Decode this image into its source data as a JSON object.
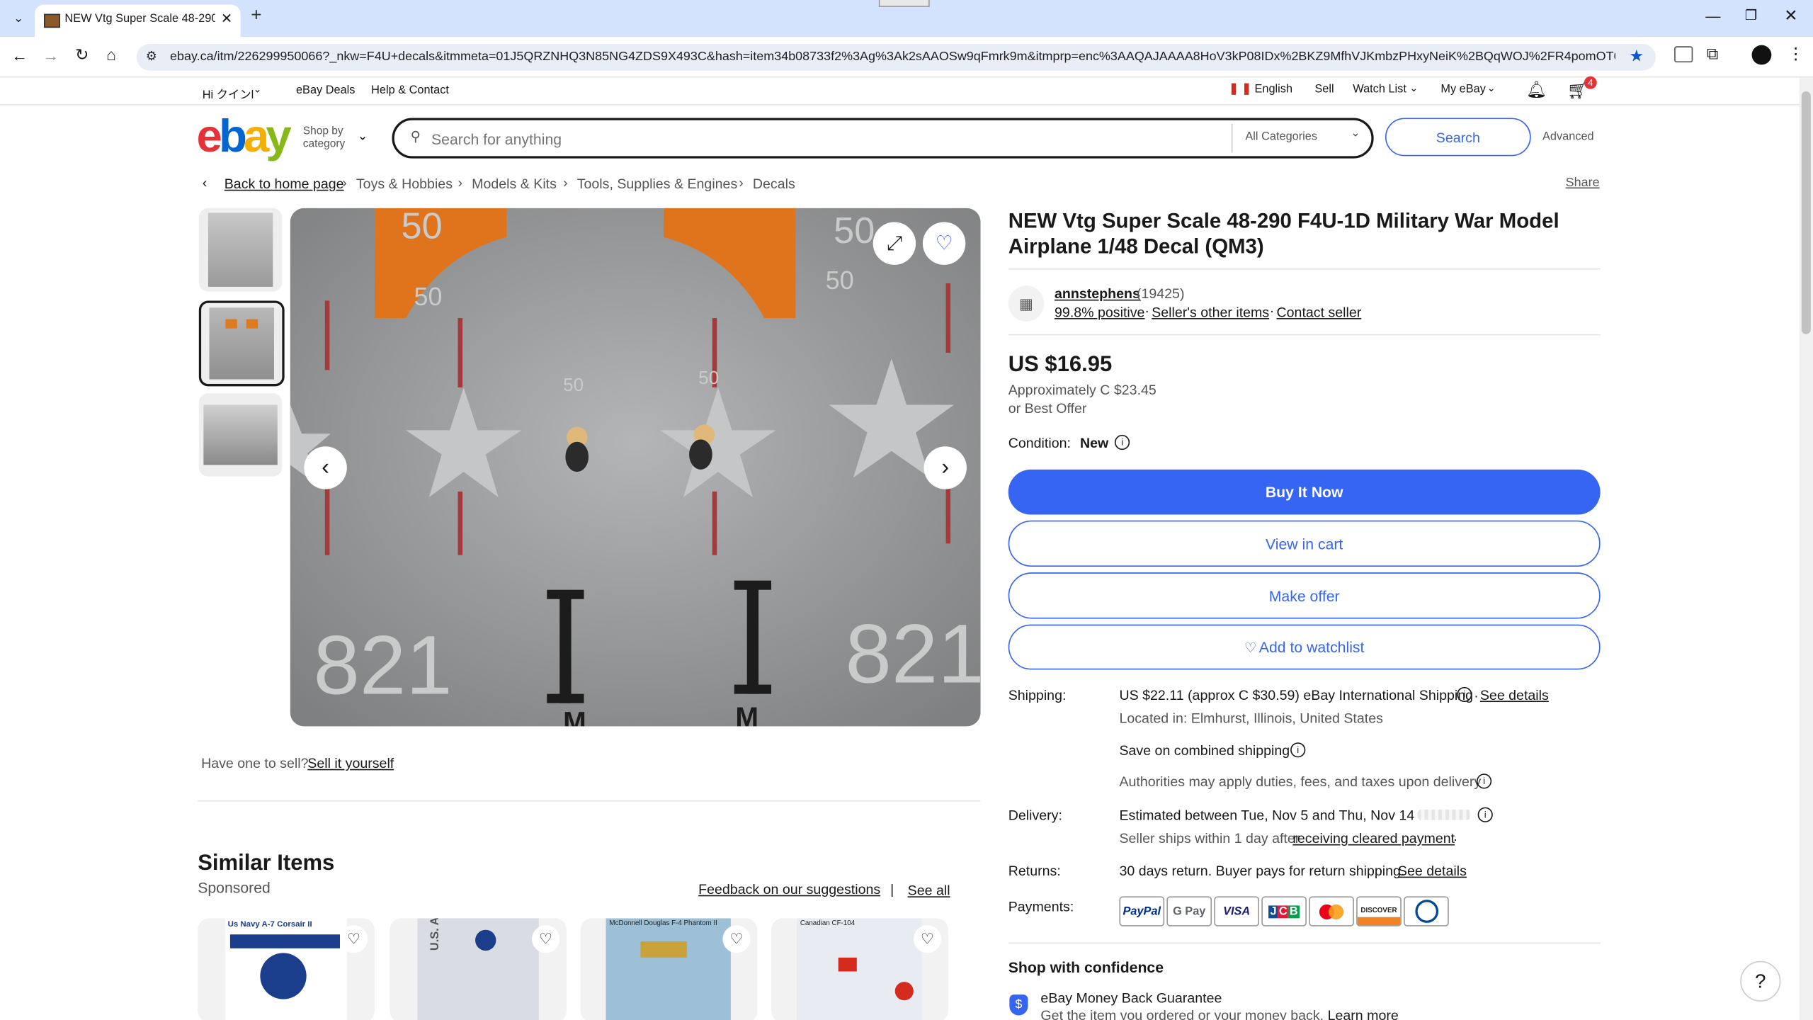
{
  "browser": {
    "tab_title": "NEW Vtg Super Scale 48-290 F4...",
    "url": "ebay.ca/itm/226299950066?_nkw=F4U+decals&itmmeta=01J5QRZNHQ3N85NG4ZDS9X493C&hash=item34b08733f2%3Ag%3Ak2sAAOSw9qFmrk9m&itmprp=enc%3AAQAJAAAA8HoV3kP08IDx%2BKZ9MfhVJKmbzPHxyNeiK%2BQqWOJ%2FR4pomOT66Q07HMeE..."
  },
  "topnav": {
    "greeting": "Hi クインl",
    "deals": "eBay Deals",
    "help": "Help & Contact",
    "language": "English",
    "sell": "Sell",
    "watchlist": "Watch List",
    "myebay": "My eBay",
    "cart_count": "4"
  },
  "header": {
    "logo_letters": [
      "e",
      "b",
      "a",
      "y"
    ],
    "logo_colors": [
      "#e53238",
      "#0064d2",
      "#f5af02",
      "#86b817"
    ],
    "shop_by_category": [
      "Shop by",
      "category"
    ],
    "search_placeholder": "Search for anything",
    "category_select": "All Categories",
    "search_button": "Search",
    "advanced": "Advanced"
  },
  "breadcrumb": {
    "back": "Back to home page",
    "items": [
      "Toys & Hobbies",
      "Models & Kits",
      "Tools, Supplies & Engines",
      "Decals"
    ],
    "share": "Share"
  },
  "item": {
    "title": "NEW Vtg Super Scale 48-290 F4U-1D Military War Model Airplane 1/48 Decal (QM3)",
    "seller_name": "annstephens",
    "seller_score": "(19425)",
    "positive": "99.8% positive",
    "other_items": "Seller's other items",
    "contact": "Contact seller",
    "price": "US $16.95",
    "approx": "Approximately C $23.45",
    "best_offer": "or Best Offer",
    "condition_label": "Condition:",
    "condition_value": "New",
    "buy_now": "Buy It Now",
    "view_cart": "View in cart",
    "make_offer": "Make offer",
    "watchlist": "Add to watchlist"
  },
  "details": {
    "shipping_label": "Shipping:",
    "shipping_value": "US $22.11 (approx C $30.59) eBay International Shipping",
    "see_details": "See details",
    "located": "Located in: Elmhurst, Illinois, United States",
    "combined": "Save on combined shipping",
    "duties": "Authorities may apply duties, fees, and taxes upon delivery",
    "delivery_label": "Delivery:",
    "delivery_value": "Estimated between Tue, Nov 5 and Thu, Nov 14 to",
    "ships_within": "Seller ships within 1 day after",
    "cleared_payment": "receiving cleared payment",
    "returns_label": "Returns:",
    "returns_value": "30 days return. Buyer pays for return shipping.",
    "returns_link": "See details",
    "payments_label": "Payments:",
    "payment_methods": [
      "PayPal",
      "G Pay",
      "VISA",
      "JCB",
      "MC",
      "DISCOVER",
      "Diners"
    ]
  },
  "confidence": {
    "heading": "Shop with confidence",
    "guarantee": "eBay Money Back Guarantee",
    "guarantee_sub": "Get the item you ordered or your money back.",
    "learn_more": "Learn more"
  },
  "sell_prompt": {
    "text": "Have one to sell?",
    "link": "Sell it yourself"
  },
  "similar": {
    "heading": "Similar Items",
    "sponsored": "Sponsored",
    "feedback": "Feedback on our suggestions",
    "see_all": "See all",
    "card_captions": [
      "Us Navy A-7 Corsair II",
      "U.S. AIR FORCE",
      "McDonnell Douglas F-4 Phantom II",
      "Canadian CF-104"
    ]
  },
  "image_text": {
    "numbers_top": "50",
    "numbers_bottom": "821",
    "letter": "I",
    "letter_small": "M"
  }
}
